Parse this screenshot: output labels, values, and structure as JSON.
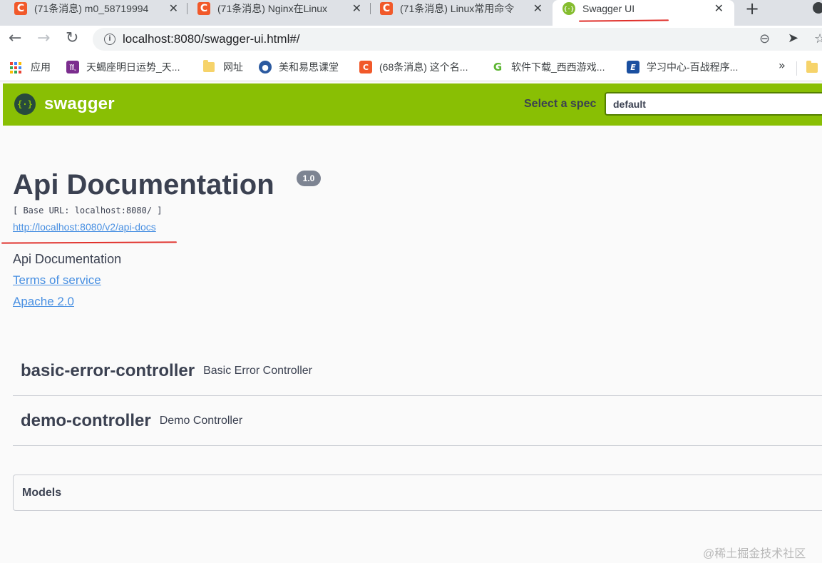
{
  "browser": {
    "tabs": [
      {
        "title": "(71条消息) m0_58719994",
        "active": false,
        "icon": "csdn-c-icon"
      },
      {
        "title": "(71条消息) Nginx在Linux",
        "active": false,
        "icon": "csdn-c-icon"
      },
      {
        "title": "(71条消息) Linux常用命令",
        "active": false,
        "icon": "csdn-c-icon"
      },
      {
        "title": "Swagger UI",
        "active": true,
        "icon": "swagger-icon"
      }
    ],
    "url": "localhost:8080/swagger-ui.html#/",
    "bookmarks": [
      {
        "label": "应用",
        "icon": "apps-grid-icon"
      },
      {
        "label": "天蝎座明日运势_天...",
        "icon": "horoscope-icon"
      },
      {
        "label": "网址",
        "icon": "folder-icon"
      },
      {
        "label": "美和易思课堂",
        "icon": "school-icon"
      },
      {
        "label": "(68条消息) 这个名...",
        "icon": "csdn-c-icon"
      },
      {
        "label": "软件下载_西西游戏...",
        "icon": "download-icon"
      },
      {
        "label": "学习中心-百战程序...",
        "icon": "study-icon"
      }
    ],
    "bookmarks_more": "»"
  },
  "topbar": {
    "brand": "swagger",
    "spec_label": "Select a spec",
    "spec_value": "default"
  },
  "info": {
    "title": "Api Documentation",
    "version": "1.0",
    "base_url": "[ Base URL: localhost:8080/ ]",
    "docs_url": "http://localhost:8080/v2/api-docs",
    "description": "Api Documentation",
    "terms_link": "Terms of service",
    "license_link": "Apache 2.0"
  },
  "tags": [
    {
      "name": "basic-error-controller",
      "description": "Basic Error Controller"
    },
    {
      "name": "demo-controller",
      "description": "Demo Controller"
    }
  ],
  "models_label": "Models",
  "watermark": "@稀土掘金技术社区",
  "colors": {
    "swagger_green": "#89bf04",
    "link_blue": "#4990e2",
    "text_dark": "#3b4151",
    "annotation_red": "#e0302b"
  }
}
